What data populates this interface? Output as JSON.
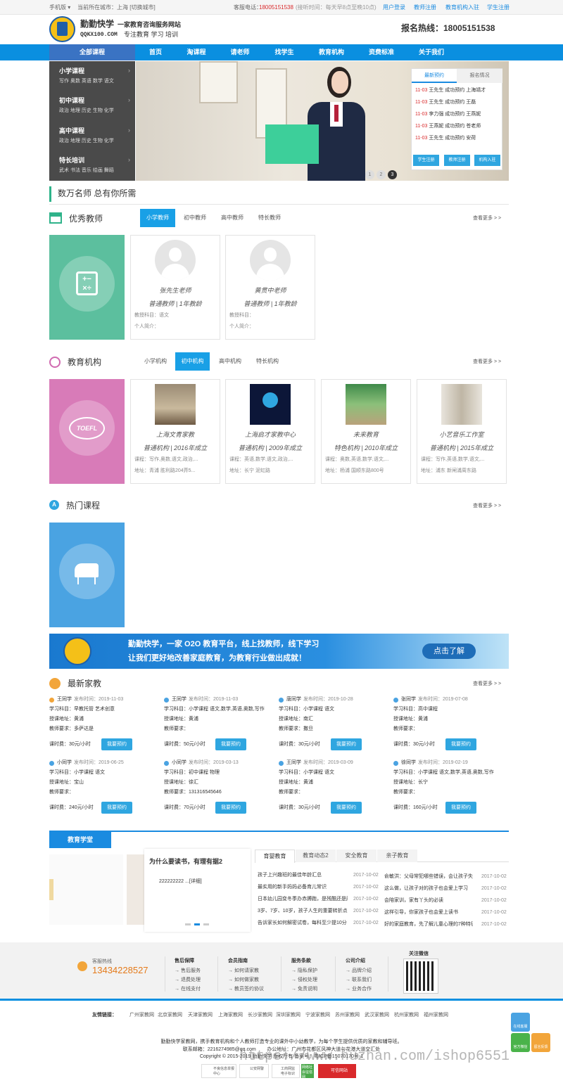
{
  "topbar": {
    "mobile": "手机版 ▾",
    "city": "当前所在城市：上海 [切换城市]",
    "service_phone_label": "客服电话：",
    "service_phone": "18005151538",
    "service_hours": "(接听时间：每天早8点至晚10点)",
    "links": [
      "用户登录",
      "教师注册",
      "教育机构入驻",
      "学生注册"
    ]
  },
  "header": {
    "brand": "勤勤快学",
    "slogan": "一家教育咨询服务网站",
    "domain": "QQKX100.COM",
    "tagline": "专注教育 学习 培训",
    "hotline": "报名热线：18005151538"
  },
  "nav": {
    "all": "全部课程",
    "items": [
      "首页",
      "淘课程",
      "请老师",
      "找学生",
      "教育机构",
      "资费标准",
      "关于我们"
    ]
  },
  "side": [
    {
      "title": "小学课程",
      "subs": "写作 奥数 英语 数学 语文"
    },
    {
      "title": "初中课程",
      "subs": "政治 地理 历史 生物 化学"
    },
    {
      "title": "高中课程",
      "subs": "政治 地理 历史 生物 化学"
    },
    {
      "title": "特长培训",
      "subs": "武术 书法 音乐 绘画 舞蹈"
    }
  ],
  "banner": {
    "dots": [
      "1",
      "2",
      "3"
    ]
  },
  "panel": {
    "tabs": [
      "最新预约",
      "报名情况"
    ],
    "rows": [
      {
        "date": "11-03",
        "text": "王先生 成功预约 上海靖才"
      },
      {
        "date": "11-03",
        "text": "王先生 成功预约 王磊"
      },
      {
        "date": "11-03",
        "text": "李力强 成功预约 王燕妮"
      },
      {
        "date": "11-03",
        "text": "王燕妮 成功预约 苍老师"
      },
      {
        "date": "11-03",
        "text": "王先生 成功预约 安荷"
      }
    ],
    "buttons": [
      "学生注册",
      "教师注册",
      "机构入驻"
    ]
  },
  "slogan": "数万名师 总有你所需",
  "teachers": {
    "title": "优秀教师",
    "tabs": [
      "小学教师",
      "初中教师",
      "高中教师",
      "特长教师"
    ],
    "more": "查看更多 > >",
    "cards": [
      {
        "name": "张先生老师",
        "level": "普通教师 | 1年教龄",
        "course": "教授科目：语文",
        "intro": "个人简介："
      },
      {
        "name": "黄贯中老师",
        "level": "普通教师 | 1年教龄",
        "course": "教授科目：",
        "intro": "个人简介："
      }
    ]
  },
  "orgs": {
    "title": "教育机构",
    "tabs": [
      "小学机构",
      "初中机构",
      "高中机构",
      "特长机构"
    ],
    "more": "查看更多 > >",
    "badge_text": "TOEFL",
    "cards": [
      {
        "name": "上海文青家教",
        "level": "普通机构 | 2016年成立",
        "course": "课程：写作,奥数,语文,政治,...",
        "addr": "地址：青浦 胜利路204弄5..."
      },
      {
        "name": "上海启才家教中心",
        "level": "普通机构 | 2009年成立",
        "course": "课程：英语,数学,语文,政治,...",
        "addr": "地址：长宁 泥虹路"
      },
      {
        "name": "未来教育",
        "level": "特色机构 | 2010年成立",
        "course": "课程：奥数,英语,数学,语文,...",
        "addr": "地址：杨浦 国顺东路800号"
      },
      {
        "name": "小艺音乐工作室",
        "level": "普通机构 | 2015年成立",
        "course": "课程：写作,英语,数学,语文,...",
        "addr": "地址：浦东 新闸浦周东路"
      }
    ]
  },
  "courses": {
    "title": "热门课程",
    "more": "查看更多 > >"
  },
  "ad": {
    "line1": "勤勤快学，一家 O2O 教育平台，线上找教师，线下学习",
    "line2": "让我们更好地改善家庭教育，为教育行业做出成就！",
    "button": "点击了解"
  },
  "jobs": {
    "title": "最新家教",
    "more": "查看更多 > >",
    "book": "我要预约",
    "items": [
      {
        "name": "王同学",
        "time": "发布时间：2019-11-03",
        "subject": "学习科目：早教托管 艺术创意",
        "addr": "授课地址：黄浦",
        "req": "教师要求：多萨达是",
        "fee": "课时费：30元/小时"
      },
      {
        "name": "王同学",
        "time": "发布时间：2019-11-03",
        "subject": "学习科目：小学课程 语文,数学,英语,奥数,写作",
        "addr": "授课地址：黄浦",
        "req": "教师要求：",
        "fee": "课时费：50元/小时"
      },
      {
        "name": "唐同学",
        "time": "发布时间：2019-10-28",
        "subject": "学习科目：小学课程 语文",
        "addr": "授课地址：南汇",
        "req": "教师要求：撒旦",
        "fee": "课时费：30元/小时"
      },
      {
        "name": "张同学",
        "time": "发布时间：2019-07-08",
        "subject": "学习科目：高中课程",
        "addr": "授课地址：黄浦",
        "req": "教师要求：",
        "fee": "课时费：30元/小时"
      },
      {
        "name": "小同学",
        "time": "发布时间：2019-06-25",
        "subject": "学习科目：小学课程 语文",
        "addr": "授课地址：宝山",
        "req": "教师要求：",
        "fee": "课时费：240元/小时"
      },
      {
        "name": "小同学",
        "time": "发布时间：2019-03-13",
        "subject": "学习科目：初中课程 物理",
        "addr": "授课地址：徐汇",
        "req": "教师要求：131316545646",
        "fee": "课时费：70元/小时"
      },
      {
        "name": "王同学",
        "time": "发布时间：2019-03-09",
        "subject": "学习科目：小学课程 语文",
        "addr": "授课地址：黄浦",
        "req": "教师要求：",
        "fee": "课时费：30元/小时"
      },
      {
        "name": "徐同学",
        "time": "发布时间：2019-02-19",
        "subject": "学习科目：小学课程 语文,数学,英语,奥数,写作",
        "addr": "授课地址：长宁",
        "req": "教师要求：",
        "fee": "课时费：160元/小时"
      }
    ]
  },
  "school": {
    "tab": "教育学堂",
    "article_title": "为什么要读书，有理有据2",
    "article_excerpt": "222222222 ...[详细]",
    "news_tabs": [
      "育婴教育",
      "教育动态2",
      "安全教育",
      "亲子教育"
    ],
    "left_news": [
      {
        "t": "孩子上兴趣班的最佳年龄汇总",
        "d": "2017-10-02"
      },
      {
        "t": "最实用的新手妈妈必备育儿常识",
        "d": "2017-10-02"
      },
      {
        "t": "日本幼儿园变冬季办赤膊跑，是残酷还是磨",
        "d": "2017-10-02"
      },
      {
        "t": "3岁、7岁、10岁，孩子人生的重要转折点",
        "d": "2017-10-02"
      },
      {
        "t": "告诉家长如何解密试卷，每科至少提10分",
        "d": "2017-10-02"
      }
    ],
    "right_news": [
      {
        "t": "俞敏洪：父母常犯哪些错误，会让孩子失去",
        "d": "2017-10-02"
      },
      {
        "t": "这么做，让孩子对的孩子也会爱上学习",
        "d": "2017-10-02"
      },
      {
        "t": "会陪家训，家有丫头的必读",
        "d": "2017-10-02"
      },
      {
        "t": "这样引导，你家孩子也会爱上读书",
        "d": "2017-10-02"
      },
      {
        "t": "好的家庭教育，先了解儿童心理的7种特征",
        "d": "2017-10-02"
      }
    ]
  },
  "footer": {
    "hotline_label": "客服热线",
    "hotline": "13434228527",
    "cols": [
      {
        "h": "售后保障",
        "items": [
          "→ 售后服务",
          "→ 退费处理",
          "→ 在线支付"
        ]
      },
      {
        "h": "会员指南",
        "items": [
          "→ 如何请家教",
          "→ 如何做家教",
          "→ 教员签约协议"
        ]
      },
      {
        "h": "服务条款",
        "items": [
          "→ 隐私保护",
          "→ 侵权处理",
          "→ 免责说明"
        ]
      },
      {
        "h": "公司介绍",
        "items": [
          "→ 品牌介绍",
          "→ 联系我们",
          "→ 业务合作"
        ]
      }
    ],
    "wechat": "关注微信",
    "friends_label": "友情链接：",
    "friends": [
      "广州家教网",
      "北京家教网",
      "天津家教网",
      "上海家教网",
      "长沙家教网",
      "深圳家教网",
      "宁波家教网",
      "苏州家教网",
      "武汉家教网",
      "杭州家教网",
      "福州家教网"
    ],
    "about": "勤勤快学家教网，携手教育机构和个人教师打造专业的课外中小幼教学，为每个学生提供优质的家教和辅导班。",
    "contact": "联系邮箱：2216274985@qq.com        办公地址：广州市花都区风神大道与花港大道交汇处",
    "copyright": "Copyright © 2015-2019 勤勤快学 版权所有 备案号：粤ICP备15070170号-1",
    "watermark": "https://www.huzhan.com/ishop6551",
    "badges": [
      "不良信息举报中心",
      "公安网警",
      "工商网监电子标识",
      "网络社会征信网",
      "可信网站"
    ],
    "side_buttons": [
      "在线客服",
      "官方微信",
      "留言反馈"
    ]
  }
}
